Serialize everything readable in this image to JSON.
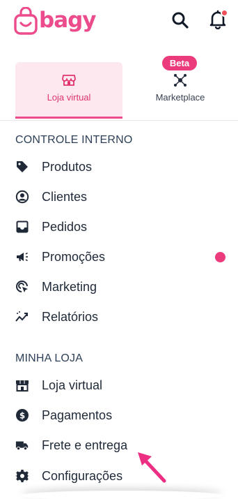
{
  "header": {
    "brand": "bagy",
    "brand_color": "#ec4c8b",
    "search_icon": "search-icon",
    "bell_icon": "bell-icon",
    "notification_color": "#f05158"
  },
  "tabs": [
    {
      "label": "Loja virtual",
      "icon": "store-icon",
      "active": true
    },
    {
      "label": "Marketplace",
      "icon": "marketplace-network-icon",
      "active": false,
      "badge": "Beta"
    }
  ],
  "sections": {
    "internal": {
      "title": "CONTROLE INTERNO",
      "items": [
        {
          "label": "Produtos",
          "icon": "tag-icon"
        },
        {
          "label": "Clientes",
          "icon": "user-circle-icon"
        },
        {
          "label": "Pedidos",
          "icon": "inbox-icon"
        },
        {
          "label": "Promoções",
          "icon": "megaphone-icon"
        },
        {
          "label": "Marketing",
          "icon": "target-cursor-icon"
        },
        {
          "label": "Relatórios",
          "icon": "trend-chart-icon"
        }
      ]
    },
    "store": {
      "title": "MINHA LOJA",
      "items": [
        {
          "label": "Loja virtual",
          "icon": "storefront-icon"
        },
        {
          "label": "Pagamentos",
          "icon": "dollar-circle-icon"
        },
        {
          "label": "Frete e entrega",
          "icon": "truck-icon"
        },
        {
          "label": "Configurações",
          "icon": "gear-icon"
        }
      ]
    }
  },
  "accent_color": "#ec3b7c"
}
